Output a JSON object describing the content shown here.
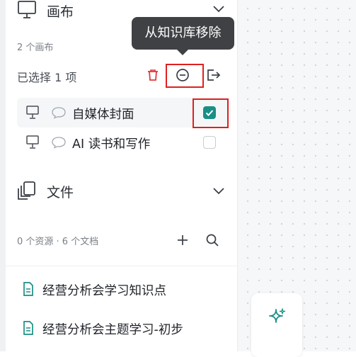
{
  "canvas_section": {
    "title": "画布",
    "count_label": "2 个画布",
    "selection_label": "已选择 1 项",
    "tooltip": "从知识库移除",
    "items": [
      {
        "label": "自媒体封面",
        "checked": true
      },
      {
        "label": "AI 读书和写作",
        "checked": false
      }
    ]
  },
  "files_section": {
    "title": "文件",
    "count_label": "0 个资源 · 6 个文档",
    "items": [
      {
        "label": "经营分析会学习知识点"
      },
      {
        "label": "经营分析会主题学习-初步"
      }
    ]
  },
  "colors": {
    "accent": "#1a8f86",
    "danger": "#e0393e",
    "highlight_box": "#e02020",
    "tooltip_bg": "#3f4145"
  }
}
